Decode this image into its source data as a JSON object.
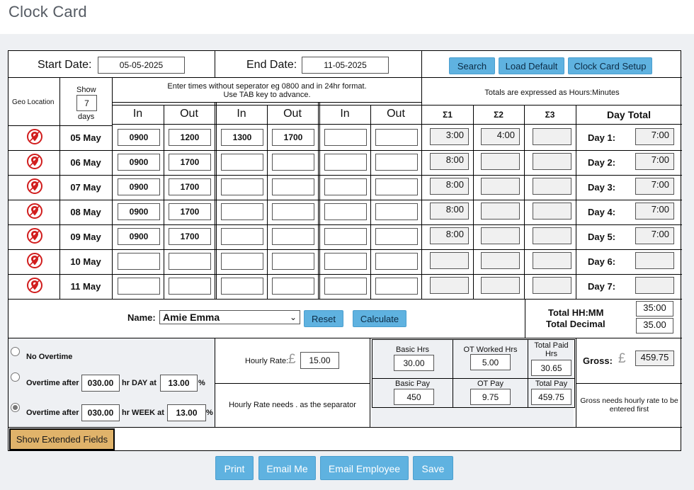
{
  "page_title": "Clock Card",
  "header": {
    "start_label": "Start Date:",
    "start_value": "05-05-2025",
    "end_label": "End Date:",
    "end_value": "11-05-2025",
    "search_label": "Search",
    "load_default_label": "Load Default",
    "setup_label": "Clock Card Setup"
  },
  "columns": {
    "geo_location": "Geo Location",
    "show_label": "Show",
    "show_value": "7",
    "days_label": "days",
    "instructions_line1": "Enter times without seperator eg 0800 and in 24hr format.",
    "instructions_line2": "Use TAB key to advance.",
    "totals_note": "Totals are expressed as Hours:Minutes",
    "in": "In",
    "out": "Out",
    "sum1": "Σ1",
    "sum2": "Σ2",
    "sum3": "Σ3",
    "day_total": "Day Total"
  },
  "rows": [
    {
      "date": "05 May",
      "in1": "0900",
      "out1": "1200",
      "in2": "1300",
      "out2": "1700",
      "in3": "",
      "out3": "",
      "s1": "3:00",
      "s2": "4:00",
      "s3": "",
      "day_label": "Day 1:",
      "day_total": "7:00"
    },
    {
      "date": "06 May",
      "in1": "0900",
      "out1": "1700",
      "in2": "",
      "out2": "",
      "in3": "",
      "out3": "",
      "s1": "8:00",
      "s2": "",
      "s3": "",
      "day_label": "Day 2:",
      "day_total": "7:00"
    },
    {
      "date": "07 May",
      "in1": "0900",
      "out1": "1700",
      "in2": "",
      "out2": "",
      "in3": "",
      "out3": "",
      "s1": "8:00",
      "s2": "",
      "s3": "",
      "day_label": "Day 3:",
      "day_total": "7:00"
    },
    {
      "date": "08 May",
      "in1": "0900",
      "out1": "1700",
      "in2": "",
      "out2": "",
      "in3": "",
      "out3": "",
      "s1": "8:00",
      "s2": "",
      "s3": "",
      "day_label": "Day 4:",
      "day_total": "7:00"
    },
    {
      "date": "09 May",
      "in1": "0900",
      "out1": "1700",
      "in2": "",
      "out2": "",
      "in3": "",
      "out3": "",
      "s1": "8:00",
      "s2": "",
      "s3": "",
      "day_label": "Day 5:",
      "day_total": "7:00"
    },
    {
      "date": "10 May",
      "in1": "",
      "out1": "",
      "in2": "",
      "out2": "",
      "in3": "",
      "out3": "",
      "s1": "",
      "s2": "",
      "s3": "",
      "day_label": "Day 6:",
      "day_total": ""
    },
    {
      "date": "11 May",
      "in1": "",
      "out1": "",
      "in2": "",
      "out2": "",
      "in3": "",
      "out3": "",
      "s1": "",
      "s2": "",
      "s3": "",
      "day_label": "Day 7:",
      "day_total": ""
    }
  ],
  "name_row": {
    "name_label": "Name:",
    "name_value": "Amie Emma",
    "reset_label": "Reset",
    "calculate_label": "Calculate",
    "total_hhmm_label": "Total HH:MM",
    "total_decimal_label": "Total Decimal",
    "total_hhmm": "35:00",
    "total_decimal": "35.00"
  },
  "overtime": {
    "no_overtime": "No Overtime",
    "after_day_prefix": "Overtime after",
    "after_day_value": "030.00",
    "after_day_mid": "hr DAY at",
    "after_day_pct": "13.00",
    "after_week_prefix": "Overtime after",
    "after_week_value": "030.00",
    "after_week_mid": "hr WEEK at",
    "after_week_pct": "13.00",
    "percent": "%",
    "selected": "week"
  },
  "rate": {
    "hourly_rate_label": "Hourly Rate:",
    "currency": "£",
    "hourly_rate": "15.00",
    "note": "Hourly Rate needs . as the separator"
  },
  "pay": {
    "basic_hrs_label": "Basic Hrs",
    "basic_hrs": "30.00",
    "ot_worked_label": "OT Worked Hrs",
    "ot_worked": "5.00",
    "total_paid_hrs_label1": "Total Paid",
    "total_paid_hrs_label2": "Hrs",
    "total_paid_hrs": "30.65",
    "basic_pay_label": "Basic Pay",
    "basic_pay": "450",
    "ot_pay_label": "OT Pay",
    "ot_pay": "9.75",
    "total_pay_label": "Total Pay",
    "total_pay": "459.75"
  },
  "gross": {
    "label": "Gross:",
    "currency": "£",
    "value": "459.75",
    "note_line1": "Gross needs hourly rate to be",
    "note_line2": "entered first"
  },
  "extended_label": "Show Extended Fields",
  "footer": {
    "print": "Print",
    "email_me": "Email Me",
    "email_employee": "Email Employee",
    "save": "Save"
  },
  "colors": {
    "button_blue": "#5fb2e0",
    "extended_button": "#e0b36a",
    "geo_red": "#d11d1d"
  }
}
